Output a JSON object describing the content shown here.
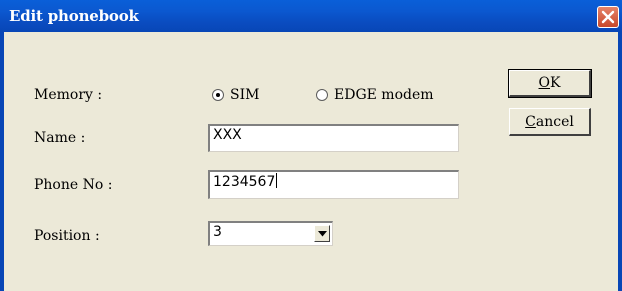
{
  "window": {
    "title": "Edit phonebook"
  },
  "form": {
    "memory_label": "Memory :",
    "memory_options": [
      "SIM",
      "EDGE modem"
    ],
    "memory_selected": "SIM",
    "name_label": "Name :",
    "name_value": "XXX",
    "phone_label": "Phone No :",
    "phone_value": "1234567",
    "position_label": "Position :",
    "position_value": "3"
  },
  "buttons": {
    "ok_accel": "O",
    "ok_rest": "K",
    "cancel_accel": "C",
    "cancel_rest": "ancel"
  },
  "colors": {
    "titlebar": "#0a54c8",
    "dialog_bg": "#ece9d8",
    "close_button": "#d9603f"
  }
}
